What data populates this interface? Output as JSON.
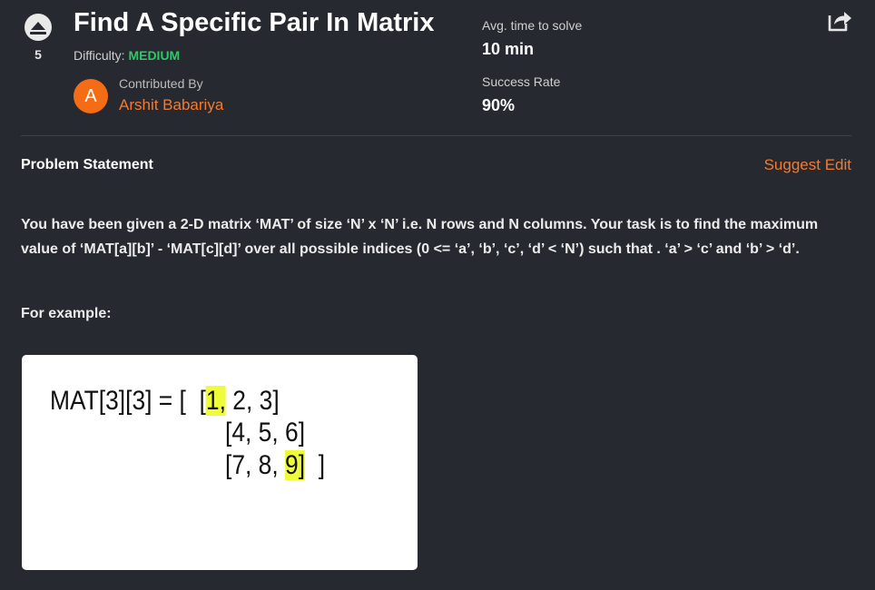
{
  "problem": {
    "upvotes": "5",
    "title": "Find A Specific Pair In Matrix",
    "difficulty_label": "Difficulty:",
    "difficulty_value": "MEDIUM",
    "contributor_label": "Contributed By",
    "contributor_initial": "A",
    "contributor_name": "Arshit Babariya"
  },
  "stats": {
    "avg_time_label": "Avg. time to solve",
    "avg_time_value": "10 min",
    "success_label": "Success Rate",
    "success_value": "90%"
  },
  "section": {
    "heading": "Problem Statement",
    "suggest_edit": "Suggest Edit",
    "statement": "You have been given a 2-D matrix ‘MAT’ of size ‘N’ x ‘N’ i.e. N rows and N columns. Your task is to find the maximum value of ‘MAT[a][b]’ - ‘MAT[c][d]’ over all possible indices (0 <= ‘a’, ‘b’, ‘c’, ‘d’ < ‘N’) such that . ‘a’ > ‘c’ and ‘b’ > ‘d’.",
    "example_label": "For example:"
  },
  "example": {
    "prefix": "MAT[3][3] = [",
    "row1_open": "[",
    "row1_hl": "1,",
    "row1_rest": " 2, 3]",
    "row2": "[4, 5, 6]",
    "row3_pre": "[7, 8, ",
    "row3_hl": "9]",
    "row3_close": "  ]"
  },
  "colors": {
    "background": "#262a30",
    "accent_orange": "#f47a2f",
    "difficulty_green": "#2ec866",
    "highlight_yellow": "#eefc3a"
  },
  "icons": {
    "upvote": "upvote-arrow-icon",
    "share": "share-icon"
  }
}
